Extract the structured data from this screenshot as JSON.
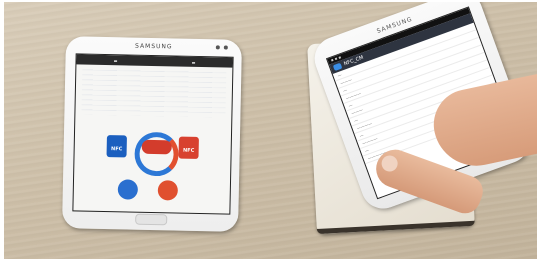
{
  "left_phone": {
    "brand": "SAMSUNG",
    "nfc_badge_left": "NFC",
    "nfc_badge_right": "NFC"
  },
  "right_phone": {
    "brand": "SAMSUNG",
    "app_title": "NFC_CM"
  }
}
